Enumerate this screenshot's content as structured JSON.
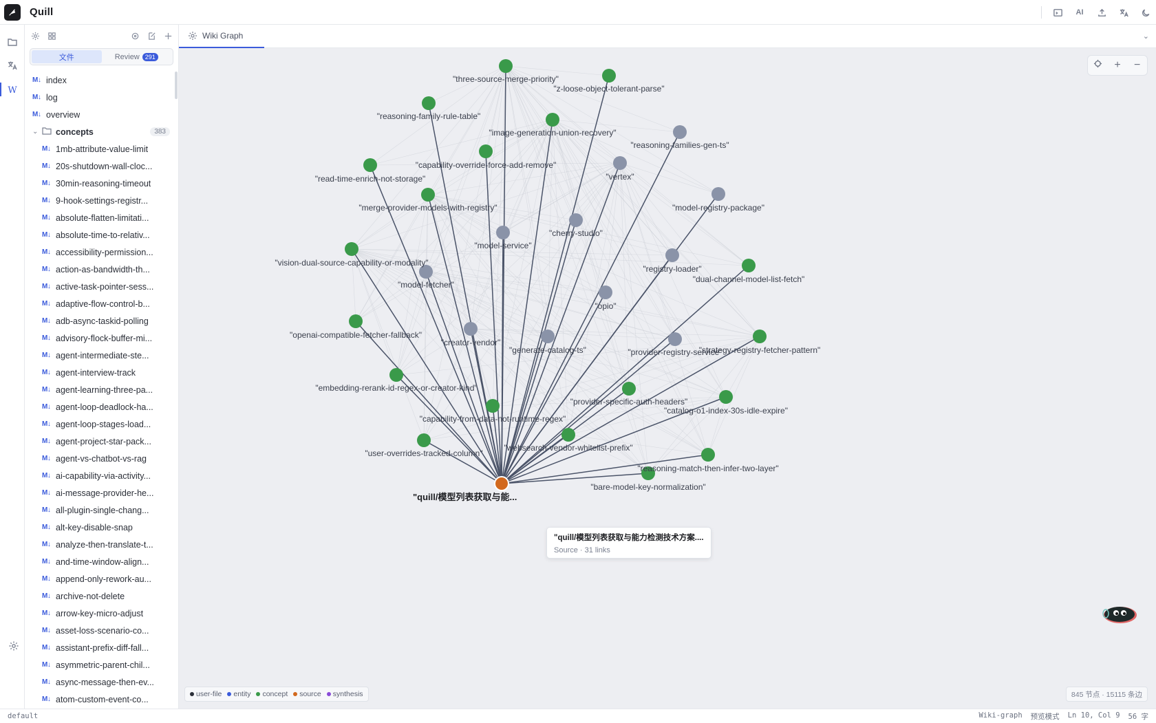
{
  "app": {
    "name": "Quill"
  },
  "sidebar": {
    "tabs": [
      {
        "label": "文件",
        "active": true
      },
      {
        "label": "Review",
        "badge": "291",
        "active": false
      }
    ],
    "top_files": [
      "index",
      "log",
      "overview"
    ],
    "folder": {
      "name": "concepts",
      "count": "383",
      "expanded": true
    },
    "concept_files": [
      "1mb-attribute-value-limit",
      "20s-shutdown-wall-cloc...",
      "30min-reasoning-timeout",
      "9-hook-settings-registr...",
      "absolute-flatten-limitati...",
      "absolute-time-to-relativ...",
      "accessibility-permission...",
      "action-as-bandwidth-th...",
      "active-task-pointer-sess...",
      "adaptive-flow-control-b...",
      "adb-async-taskid-polling",
      "advisory-flock-buffer-mi...",
      "agent-intermediate-ste...",
      "agent-interview-track",
      "agent-learning-three-pa...",
      "agent-loop-deadlock-ha...",
      "agent-loop-stages-load...",
      "agent-project-star-pack...",
      "agent-vs-chatbot-vs-rag",
      "ai-capability-via-activity...",
      "ai-message-provider-he...",
      "all-plugin-single-chang...",
      "alt-key-disable-snap",
      "analyze-then-translate-t...",
      "and-time-window-align...",
      "append-only-rework-au...",
      "archive-not-delete",
      "arrow-key-micro-adjust",
      "asset-loss-scenario-co...",
      "assistant-prefix-diff-fall...",
      "asymmetric-parent-chil...",
      "async-message-then-ev...",
      "atom-custom-event-co..."
    ],
    "md_badge": "M↓"
  },
  "editor": {
    "tab_label": "Wiki Graph"
  },
  "graph": {
    "colors": {
      "concept": "#3a9a4a",
      "entity": "#8a93a8",
      "source": "#d2691e",
      "edge": "#4a5368",
      "faint_edge": "#c9ccd4"
    },
    "center": {
      "label": "\"quill/模型列表获取与能..."
    },
    "nodes": [
      {
        "label": "\"three-source-merge-priority\"",
        "type": "concept"
      },
      {
        "label": "\"z-loose-object-tolerant-parse\"",
        "type": "concept"
      },
      {
        "label": "\"reasoning-family-rule-table\"",
        "type": "concept"
      },
      {
        "label": "\"image-generation-union-recovery\"",
        "type": "concept"
      },
      {
        "label": "\"reasoning-families-gen-ts\"",
        "type": "entity"
      },
      {
        "label": "\"capability-override-force-add-remove\"",
        "type": "concept"
      },
      {
        "label": "\"vertex\"",
        "type": "entity"
      },
      {
        "label": "\"read-time-enrich-not-storage\"",
        "type": "concept"
      },
      {
        "label": "\"model-registry-package\"",
        "type": "entity"
      },
      {
        "label": "\"merge-provider-models-with-registry\"",
        "type": "concept"
      },
      {
        "label": "\"cherry-studio\"",
        "type": "entity"
      },
      {
        "label": "\"model-service\"",
        "type": "entity"
      },
      {
        "label": "\"vision-dual-source-capability-or-modality\"",
        "type": "concept"
      },
      {
        "label": "\"registry-loader\"",
        "type": "entity"
      },
      {
        "label": "\"dual-channel-model-list-fetch\"",
        "type": "concept"
      },
      {
        "label": "\"model-fetcher\"",
        "type": "entity"
      },
      {
        "label": "\"opio\"",
        "type": "entity"
      },
      {
        "label": "\"openai-compatible-fetcher-fallback\"",
        "type": "concept"
      },
      {
        "label": "\"creator-vendor\"",
        "type": "entity"
      },
      {
        "label": "\"generate-catalog-ts\"",
        "type": "entity"
      },
      {
        "label": "\"provider-registry-service\"",
        "type": "entity"
      },
      {
        "label": "\"strategy-registry-fetcher-pattern\"",
        "type": "concept"
      },
      {
        "label": "\"embedding-rerank-id-regex-or-creator-kind\"",
        "type": "concept"
      },
      {
        "label": "\"provider-specific-auth-headers\"",
        "type": "concept"
      },
      {
        "label": "\"catalog-o1-index-30s-idle-expire\"",
        "type": "concept"
      },
      {
        "label": "\"capability-from-data-not-runtime-regex\"",
        "type": "concept"
      },
      {
        "label": "\"user-overrides-tracked-column\"",
        "type": "concept"
      },
      {
        "label": "\"websearch-vendor-whitelist-prefix\"",
        "type": "concept"
      },
      {
        "label": "\"reasoning-match-then-infer-two-layer\"",
        "type": "concept"
      },
      {
        "label": "\"bare-model-key-normalization\"",
        "type": "concept"
      }
    ],
    "tooltip": {
      "title": "\"quill/模型列表获取与能力检测技术方案....",
      "subtitle": "Source · 31 links"
    },
    "legend": [
      {
        "label": "user-file",
        "color": "#2b2f38"
      },
      {
        "label": "entity",
        "color": "#3b5bdb"
      },
      {
        "label": "concept",
        "color": "#3a9a4a"
      },
      {
        "label": "source",
        "color": "#d2691e"
      },
      {
        "label": "synthesis",
        "color": "#8a4bd8"
      }
    ],
    "stats": "845 节点 · 15115 条边"
  },
  "statusbar": {
    "left": "default",
    "mode": "Wiki-graph",
    "preview": "预览模式",
    "position": "Ln 10, Col 9",
    "words": "56 字"
  }
}
